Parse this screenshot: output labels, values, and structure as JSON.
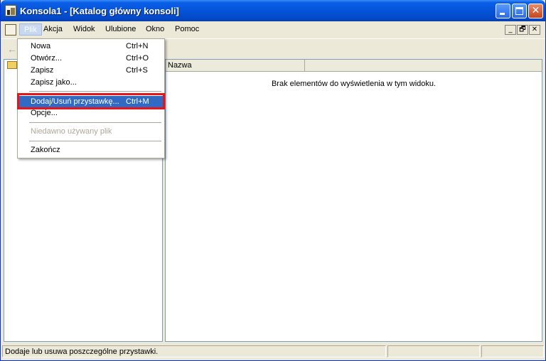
{
  "window": {
    "title": "Konsola1 - [Katalog główny konsoli]"
  },
  "menubar": {
    "items": [
      "Plik",
      "Akcja",
      "Widok",
      "Ulubione",
      "Okno",
      "Pomoc"
    ],
    "active": "Plik"
  },
  "mdi_controls": [
    "_",
    "🗗",
    "✕"
  ],
  "file_menu": {
    "items": [
      {
        "label": "Nowa",
        "shortcut": "Ctrl+N"
      },
      {
        "label": "Otwórz...",
        "shortcut": "Ctrl+O"
      },
      {
        "label": "Zapisz",
        "shortcut": "Ctrl+S"
      },
      {
        "label": "Zapisz jako...",
        "shortcut": ""
      },
      {
        "label": "Dodaj/Usuń przystawkę...",
        "shortcut": "Ctrl+M",
        "highlighted": true
      },
      {
        "label": "Opcje...",
        "shortcut": ""
      },
      {
        "label": "Niedawno używany plik",
        "shortcut": "",
        "disabled": true
      },
      {
        "label": "Zakończ",
        "shortcut": ""
      }
    ]
  },
  "list_view": {
    "column_name": "Nazwa",
    "empty_message": "Brak elementów do wyświetlenia w tym widoku."
  },
  "statusbar": {
    "text": "Dodaje lub usuwa poszczególne przystawki."
  },
  "colors": {
    "highlight": "#316ac5",
    "annotation_box": "#e8141a",
    "titlebar": "#0553d8"
  }
}
